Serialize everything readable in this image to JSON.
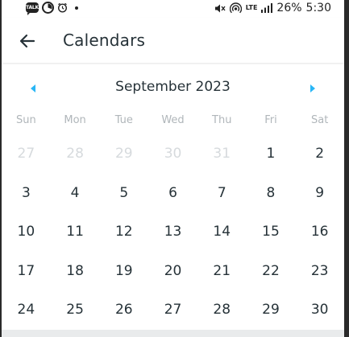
{
  "status_bar": {
    "time": "5:30",
    "battery": "26%",
    "network": "LTE",
    "icons": [
      "chat-bubble-icon",
      "timer-icon",
      "alarm-icon",
      "notification-dot-icon",
      "mute-icon",
      "hotspot-icon",
      "lte-icon",
      "signal-icon"
    ]
  },
  "app_bar": {
    "title": "Calendars",
    "back_icon": "arrow-left-icon"
  },
  "calendar": {
    "month_label": "September 2023",
    "accent_color": "#29b6f6",
    "weekdays": [
      "Sun",
      "Mon",
      "Tue",
      "Wed",
      "Thu",
      "Fri",
      "Sat"
    ],
    "weeks": [
      [
        {
          "d": "27",
          "muted": true
        },
        {
          "d": "28",
          "muted": true
        },
        {
          "d": "29",
          "muted": true
        },
        {
          "d": "30",
          "muted": true
        },
        {
          "d": "31",
          "muted": true
        },
        {
          "d": "1",
          "muted": false
        },
        {
          "d": "2",
          "muted": false
        }
      ],
      [
        {
          "d": "3",
          "muted": false
        },
        {
          "d": "4",
          "muted": false
        },
        {
          "d": "5",
          "muted": false
        },
        {
          "d": "6",
          "muted": false
        },
        {
          "d": "7",
          "muted": false
        },
        {
          "d": "8",
          "muted": false
        },
        {
          "d": "9",
          "muted": false
        }
      ],
      [
        {
          "d": "10",
          "muted": false
        },
        {
          "d": "11",
          "muted": false
        },
        {
          "d": "12",
          "muted": false
        },
        {
          "d": "13",
          "muted": false
        },
        {
          "d": "14",
          "muted": false
        },
        {
          "d": "15",
          "muted": false
        },
        {
          "d": "16",
          "muted": false
        }
      ],
      [
        {
          "d": "17",
          "muted": false
        },
        {
          "d": "18",
          "muted": false
        },
        {
          "d": "19",
          "muted": false
        },
        {
          "d": "20",
          "muted": false
        },
        {
          "d": "21",
          "muted": false
        },
        {
          "d": "22",
          "muted": false
        },
        {
          "d": "23",
          "muted": false
        }
      ],
      [
        {
          "d": "24",
          "muted": false
        },
        {
          "d": "25",
          "muted": false
        },
        {
          "d": "26",
          "muted": false
        },
        {
          "d": "27",
          "muted": false
        },
        {
          "d": "28",
          "muted": false
        },
        {
          "d": "29",
          "muted": false
        },
        {
          "d": "30",
          "muted": false
        }
      ]
    ]
  }
}
